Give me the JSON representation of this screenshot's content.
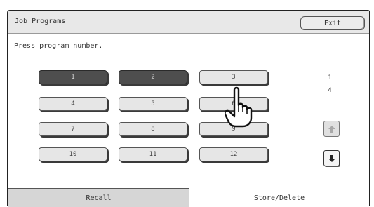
{
  "header": {
    "title": "Job Programs",
    "exit_label": "Exit"
  },
  "prompt": "Press program number.",
  "programs": [
    {
      "label": "1",
      "stored": true
    },
    {
      "label": "2",
      "stored": true
    },
    {
      "label": "3",
      "stored": false
    },
    {
      "label": "4",
      "stored": false
    },
    {
      "label": "5",
      "stored": false
    },
    {
      "label": "6",
      "stored": false
    },
    {
      "label": "7",
      "stored": false
    },
    {
      "label": "8",
      "stored": false
    },
    {
      "label": "9",
      "stored": false
    },
    {
      "label": "10",
      "stored": false
    },
    {
      "label": "11",
      "stored": false
    },
    {
      "label": "12",
      "stored": false
    }
  ],
  "pager": {
    "current": "1",
    "total": "4",
    "up_icon": "arrow-up-icon",
    "down_icon": "arrow-down-icon"
  },
  "tabs": [
    {
      "label": "Recall",
      "active": false
    },
    {
      "label": "Store/Delete",
      "active": true
    }
  ],
  "colors": {
    "stored_button": "#4e4e4e",
    "empty_button": "#e6e6e6",
    "header_bg": "#e8e8e8"
  }
}
